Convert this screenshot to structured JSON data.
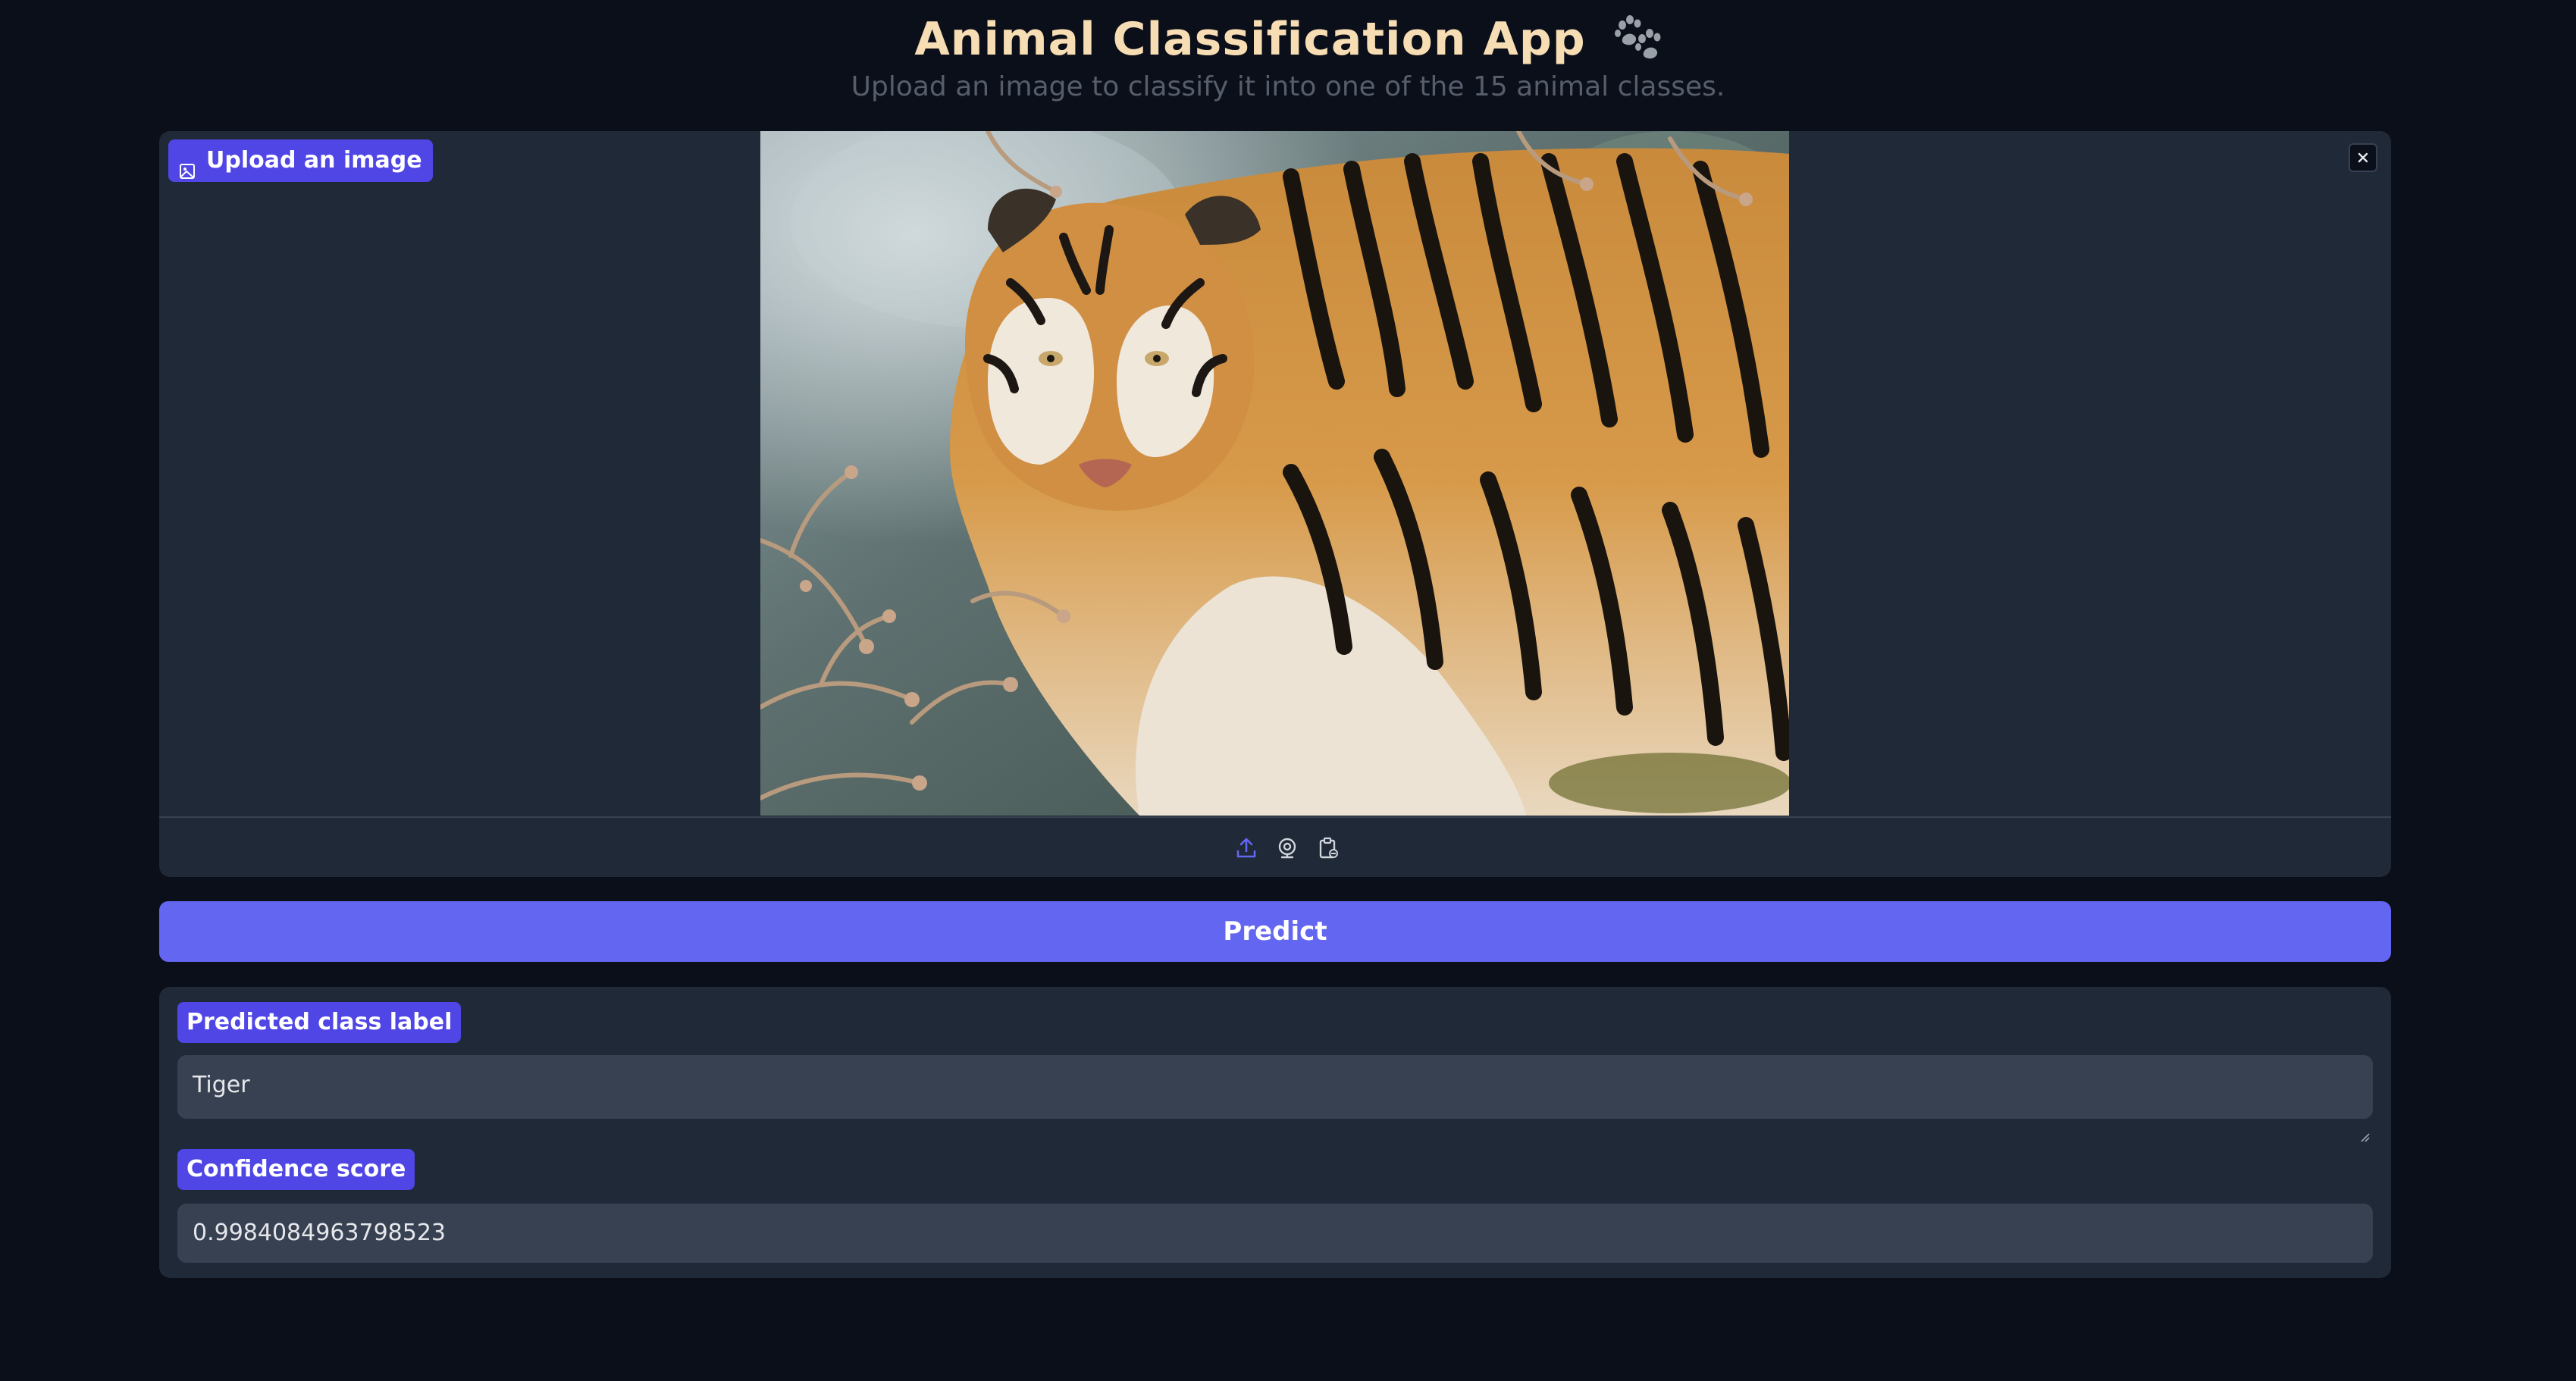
{
  "header": {
    "title": "Animal Classification App",
    "title_icon": "paw-prints-icon",
    "subtitle": "Upload an image to classify it into one of the 15 animal classes."
  },
  "image_input": {
    "label": "Upload an image",
    "label_icon": "image-icon",
    "close_icon": "close-icon",
    "image_subject": "tiger",
    "sources": [
      "upload-icon",
      "webcam-icon",
      "clipboard-icon"
    ]
  },
  "predict_button": {
    "label": "Predict"
  },
  "outputs": {
    "class_label": {
      "label": "Predicted class label",
      "value": "Tiger"
    },
    "confidence": {
      "label": "Confidence score",
      "value": "0.9984084963798523"
    }
  },
  "colors": {
    "background": "#0b0f19",
    "panel": "#1f2937",
    "accent": "#6366f1",
    "label_bg": "#4f46e5",
    "title": "#f7ddb3",
    "field": "#374151"
  }
}
